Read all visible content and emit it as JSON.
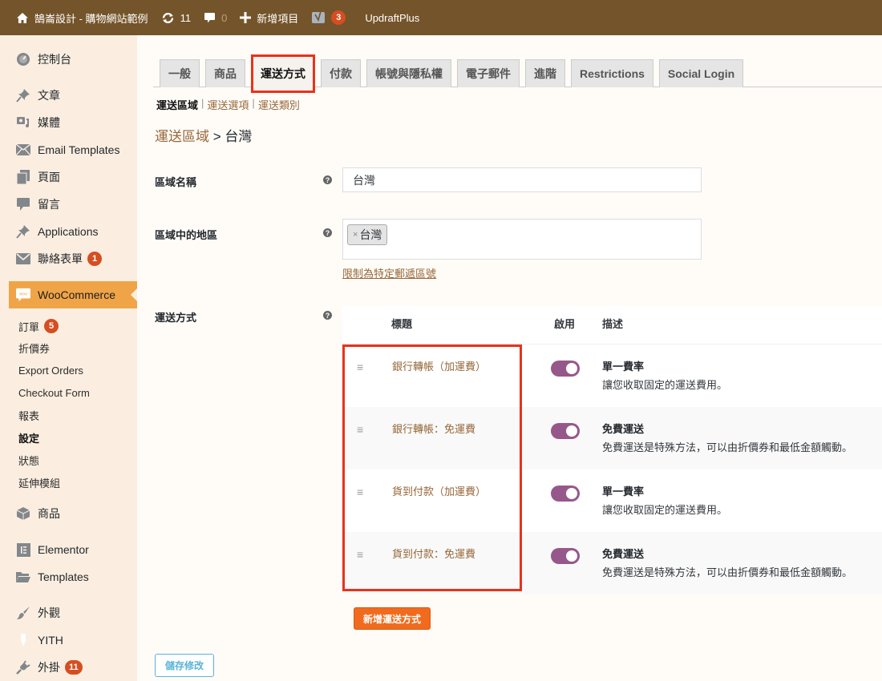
{
  "adminbar": {
    "site_title": "鵠崙設計 - 購物網站範例",
    "updates_count": "11",
    "comments_count": "0",
    "new_item_label": "新增項目",
    "yoast_badge": "3",
    "updraft_label": "UpdraftPlus"
  },
  "sidebar": {
    "items": [
      {
        "label": "控制台",
        "icon": "dashboard-icon"
      },
      {
        "label": "文章",
        "icon": "pin-icon"
      },
      {
        "label": "媒體",
        "icon": "media-icon"
      },
      {
        "label": "Email Templates",
        "icon": "envelope-icon"
      },
      {
        "label": "頁面",
        "icon": "pages-icon"
      },
      {
        "label": "留言",
        "icon": "comment-icon"
      },
      {
        "label": "Applications",
        "icon": "pin-icon"
      },
      {
        "label": "聯絡表單",
        "icon": "mail-icon",
        "badge": "1"
      },
      {
        "label": "WooCommerce",
        "icon": "woo-icon"
      },
      {
        "label": "商品",
        "icon": "box-icon"
      },
      {
        "label": "Elementor",
        "icon": "elementor-icon"
      },
      {
        "label": "Templates",
        "icon": "folder-icon"
      },
      {
        "label": "外觀",
        "icon": "brush-icon"
      },
      {
        "label": "YITH",
        "icon": "yith-icon"
      },
      {
        "label": "外掛",
        "icon": "plug-icon",
        "badge": "11"
      }
    ],
    "woo_submenu": [
      {
        "label": "訂單",
        "badge": "5"
      },
      {
        "label": "折價券"
      },
      {
        "label": "Export Orders"
      },
      {
        "label": "Checkout Form"
      },
      {
        "label": "報表"
      },
      {
        "label": "設定",
        "current": true
      },
      {
        "label": "狀態"
      },
      {
        "label": "延伸模組"
      }
    ]
  },
  "tabs": [
    "一般",
    "商品",
    "運送方式",
    "付款",
    "帳號與隱私權",
    "電子郵件",
    "進階",
    "Restrictions",
    "Social Login"
  ],
  "active_tab": "運送方式",
  "subsub": [
    "運送區域",
    "運送選項",
    "運送類別"
  ],
  "breadcrumb": {
    "link": "運送區域",
    "separator": ">",
    "current": "台灣"
  },
  "form": {
    "zone_name_label": "區域名稱",
    "zone_name_value": "台灣",
    "zone_regions_label": "區域中的地區",
    "zone_region_chip": "台灣",
    "postcode_link": "限制為特定郵遞區號",
    "methods_label": "運送方式",
    "help_glyph": "?"
  },
  "methods_table": {
    "headers": {
      "title": "標題",
      "enabled": "啟用",
      "description": "描述"
    },
    "rows": [
      {
        "title": "銀行轉帳（加運費）",
        "enabled": true,
        "type": "單一費率",
        "desc": "讓您收取固定的運送費用。"
      },
      {
        "title": "銀行轉帳：免運費",
        "enabled": true,
        "type": "免費運送",
        "desc": "免費運送是特殊方法，可以由折價券和最低金額觸動。"
      },
      {
        "title": "貨到付款（加運費）",
        "enabled": true,
        "type": "單一費率",
        "desc": "讓您收取固定的運送費用。"
      },
      {
        "title": "貨到付款：免運費",
        "enabled": true,
        "type": "免費運送",
        "desc": "免費運送是特殊方法，可以由折價券和最低金額觸動。"
      }
    ]
  },
  "buttons": {
    "add_method": "新增運送方式",
    "save": "儲存修改"
  },
  "colors": {
    "adminbar": "#74542a",
    "sidebar": "#fbeee0",
    "accent": "#f0a448",
    "toggle": "#96588a",
    "link": "#96673a",
    "highlight": "#e8321c",
    "add_button": "#f16b1e"
  }
}
